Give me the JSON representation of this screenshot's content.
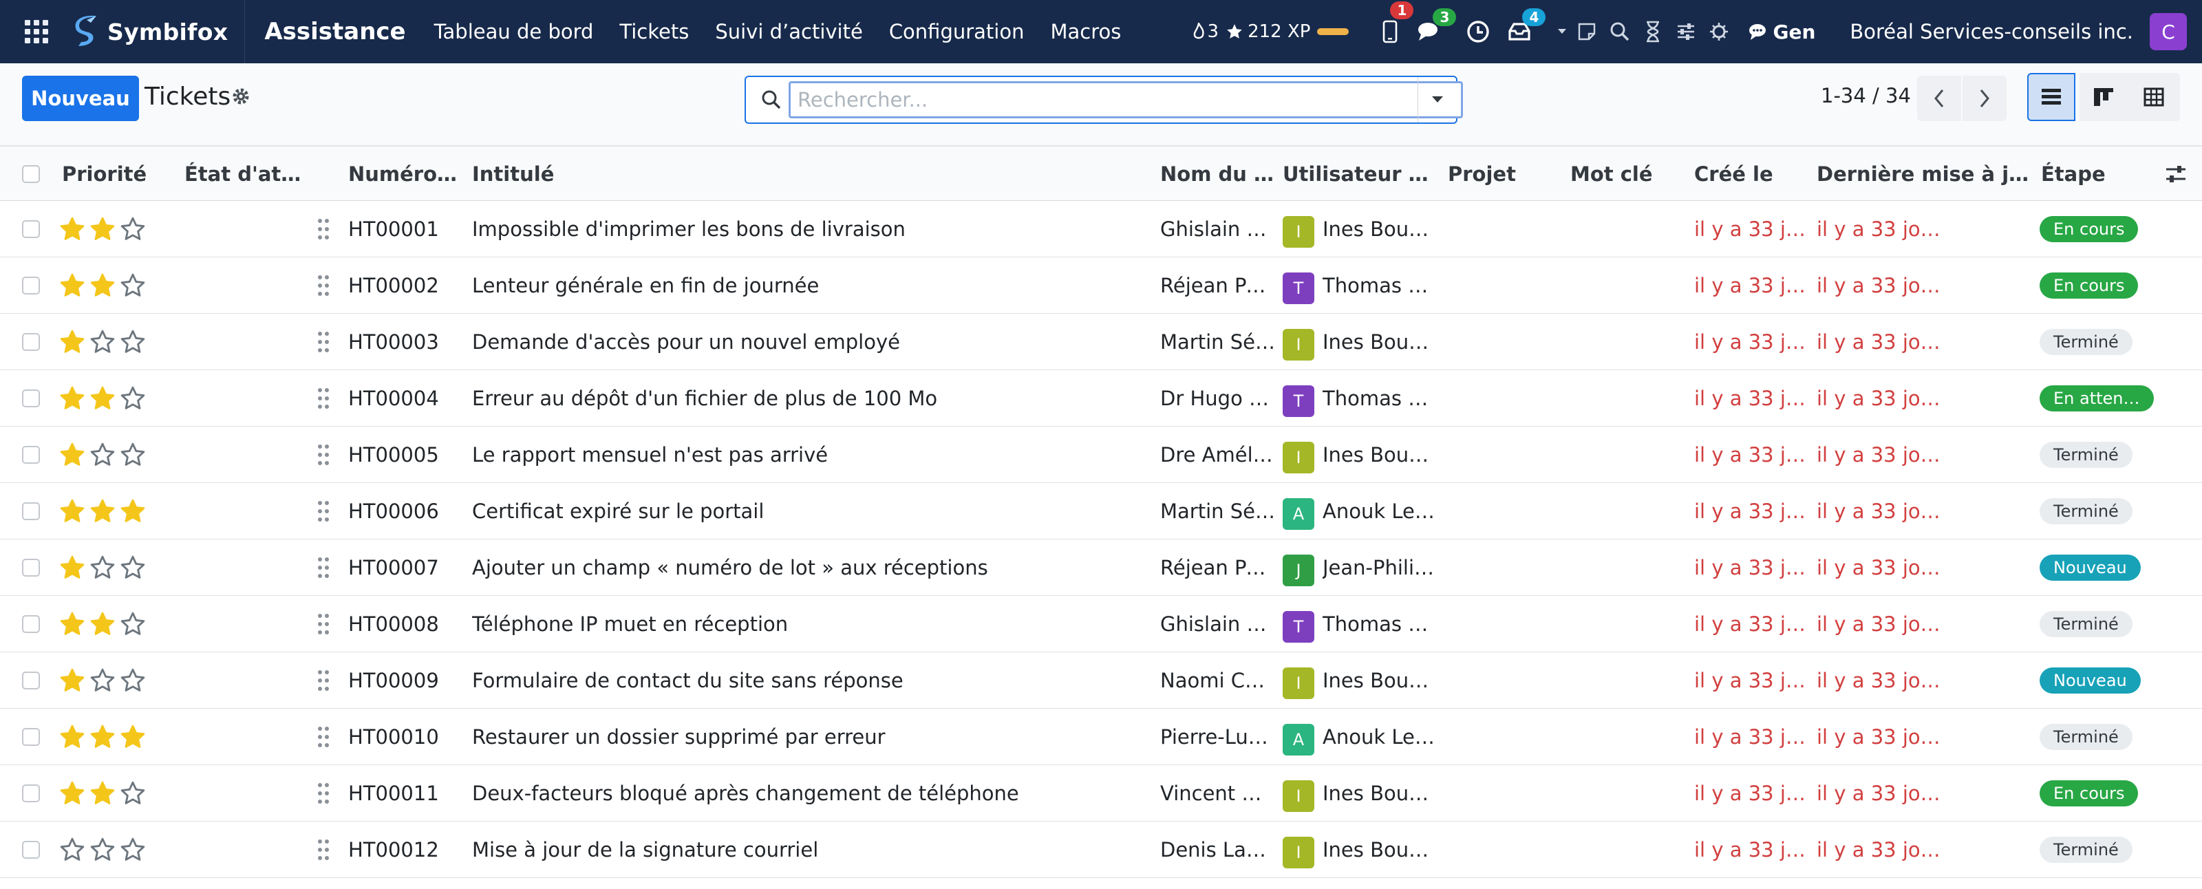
{
  "topbar": {
    "brand": "Symbifox",
    "app": "Assistance",
    "menu": [
      "Tableau de bord",
      "Tickets",
      "Suivi d’activité",
      "Configuration",
      "Macros"
    ],
    "streak": "3",
    "xp": "212 XP",
    "badges": {
      "phone": "1",
      "chat": "3",
      "inbox": "4"
    },
    "gen": "Gen",
    "company": "Boréal Services-conseils inc.",
    "avatar": "C"
  },
  "control": {
    "new_button": "Nouveau",
    "title": "Tickets",
    "search_placeholder": "Rechercher...",
    "pager": "1-34 / 34"
  },
  "columns": {
    "priority": "Priorité",
    "state": "État d'att…",
    "number": "Numéro …",
    "title": "Intitulé",
    "partner": "Nom du p…",
    "user": "Utilisateur as…",
    "project": "Projet",
    "tag": "Mot clé",
    "created": "Créé le",
    "updated": "Dernière mise à jou…",
    "stage": "Étape"
  },
  "colors": {
    "green": "#28a745",
    "blue": "#17a2b8",
    "grey": "#e9ecef",
    "olive": "#a4b726",
    "purple": "#7e3fbf",
    "teal": "#2bb580",
    "jgreen": "#2f9e44",
    "star": "#f4c61a"
  },
  "rows": [
    {
      "stars": 2,
      "number": "HT00001",
      "title": "Impossible d'imprimer les bons de livraison",
      "partner": "Ghislain P…",
      "user": "Ines Bouc…",
      "initial": "I",
      "av": "olive",
      "created": "il y a 33 jours",
      "updated": "il y a 33 jours",
      "stage": "En cours",
      "stage_color": "green"
    },
    {
      "stars": 2,
      "number": "HT00002",
      "title": "Lenteur générale en fin de journée",
      "partner": "Réjean Po…",
      "user": "Thomas Gi…",
      "initial": "T",
      "av": "purple",
      "created": "il y a 33 jours",
      "updated": "il y a 33 jours",
      "stage": "En cours",
      "stage_color": "green"
    },
    {
      "stars": 1,
      "number": "HT00003",
      "title": "Demande d'accès pour un nouvel employé",
      "partner": "Martin Sé…",
      "user": "Ines Bouc…",
      "initial": "I",
      "av": "olive",
      "created": "il y a 33 jours",
      "updated": "il y a 33 jours",
      "stage": "Terminé",
      "stage_color": "grey"
    },
    {
      "stars": 2,
      "number": "HT00004",
      "title": "Erreur au dépôt d'un fichier de plus de 100 Mo",
      "partner": "Dr Hugo B…",
      "user": "Thomas Gi…",
      "initial": "T",
      "av": "purple",
      "created": "il y a 33 jours",
      "updated": "il y a 33 jours",
      "stage": "En atten…",
      "stage_color": "green"
    },
    {
      "stars": 1,
      "number": "HT00005",
      "title": "Le rapport mensuel n'est pas arrivé",
      "partner": "Dre Améli…",
      "user": "Ines Bouc…",
      "initial": "I",
      "av": "olive",
      "created": "il y a 33 jours",
      "updated": "il y a 33 jours",
      "stage": "Terminé",
      "stage_color": "grey"
    },
    {
      "stars": 3,
      "number": "HT00006",
      "title": "Certificat expiré sur le portail",
      "partner": "Martin Sé…",
      "user": "Anouk Le…",
      "initial": "A",
      "av": "teal",
      "created": "il y a 33 jours",
      "updated": "il y a 33 jours",
      "stage": "Terminé",
      "stage_color": "grey"
    },
    {
      "stars": 1,
      "number": "HT00007",
      "title": "Ajouter un champ « numéro de lot » aux réceptions",
      "partner": "Réjean Po…",
      "user": "Jean-Phili…",
      "initial": "J",
      "av": "jgreen",
      "created": "il y a 33 jours",
      "updated": "il y a 33 jours",
      "stage": "Nouveau",
      "stage_color": "blue"
    },
    {
      "stars": 2,
      "number": "HT00008",
      "title": "Téléphone IP muet en réception",
      "partner": "Ghislain P…",
      "user": "Thomas Gi…",
      "initial": "T",
      "av": "purple",
      "created": "il y a 33 jours",
      "updated": "il y a 33 jours",
      "stage": "Terminé",
      "stage_color": "grey"
    },
    {
      "stars": 1,
      "number": "HT00009",
      "title": "Formulaire de contact du site sans réponse",
      "partner": "Naomi Ch…",
      "user": "Ines Bouc…",
      "initial": "I",
      "av": "olive",
      "created": "il y a 33 jours",
      "updated": "il y a 33 jours",
      "stage": "Nouveau",
      "stage_color": "blue"
    },
    {
      "stars": 3,
      "number": "HT00010",
      "title": "Restaurer un dossier supprimé par erreur",
      "partner": "Pierre-Luc…",
      "user": "Anouk Le…",
      "initial": "A",
      "av": "teal",
      "created": "il y a 33 jours",
      "updated": "il y a 33 jours",
      "stage": "Terminé",
      "stage_color": "grey"
    },
    {
      "stars": 2,
      "number": "HT00011",
      "title": "Deux-facteurs bloqué après changement de téléphone",
      "partner": "Vincent M…",
      "user": "Ines Bouc…",
      "initial": "I",
      "av": "olive",
      "created": "il y a 33 jours",
      "updated": "il y a 33 jours",
      "stage": "En cours",
      "stage_color": "green"
    },
    {
      "stars": 0,
      "number": "HT00012",
      "title": "Mise à jour de la signature courriel",
      "partner": "Denis Lau…",
      "user": "Ines Bouc…",
      "initial": "I",
      "av": "olive",
      "created": "il y a 33 jours",
      "updated": "il y a 33 jours",
      "stage": "Terminé",
      "stage_color": "grey"
    }
  ]
}
